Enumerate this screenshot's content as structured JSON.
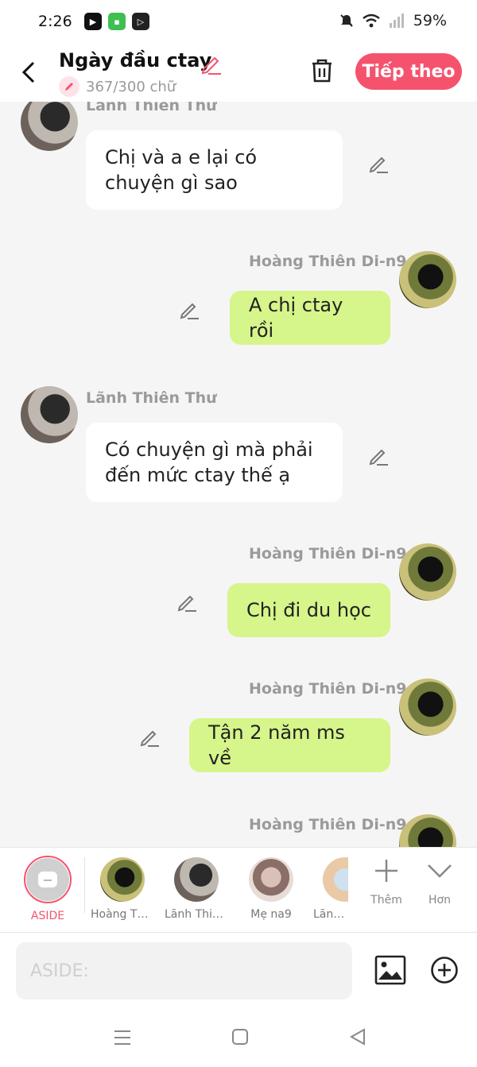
{
  "status": {
    "time": "2:26",
    "battery": "59%",
    "app_icons": [
      "youtube-icon",
      "wechat-icon",
      "video-icon"
    ]
  },
  "header": {
    "title": "Ngày đầu ctay",
    "char_count": "367/300 chữ",
    "next_label": "Tiếp theo",
    "accent": "#f5536d"
  },
  "messages": [
    {
      "side": "left",
      "sender": "Lãnh Thiên Thư",
      "text": "Chị và a e lại có chuyện gì sao"
    },
    {
      "side": "right",
      "sender": "Hoàng Thiên Di-n9",
      "text": "A chị ctay rồi"
    },
    {
      "side": "left",
      "sender": "Lãnh Thiên Thư",
      "text": "Có chuyện gì mà phải đến mức ctay thế ạ"
    },
    {
      "side": "right",
      "sender": "Hoàng Thiên Di-n9",
      "text": "Chị đi du học"
    },
    {
      "side": "right",
      "sender": "Hoàng Thiên Di-n9",
      "text": "Tận 2 năm ms về"
    },
    {
      "side": "right",
      "sender": "Hoàng Thiên Di-n9",
      "text": ""
    }
  ],
  "switcher": {
    "aside_label": "ASIDE",
    "characters": [
      "Hoàng Thi...",
      "Lãnh Thiê...",
      "Mẹ na9",
      "Lãnh T"
    ],
    "more_label": "Thêm",
    "expand_label": "Hơn"
  },
  "composer": {
    "placeholder": "ASIDE:"
  }
}
